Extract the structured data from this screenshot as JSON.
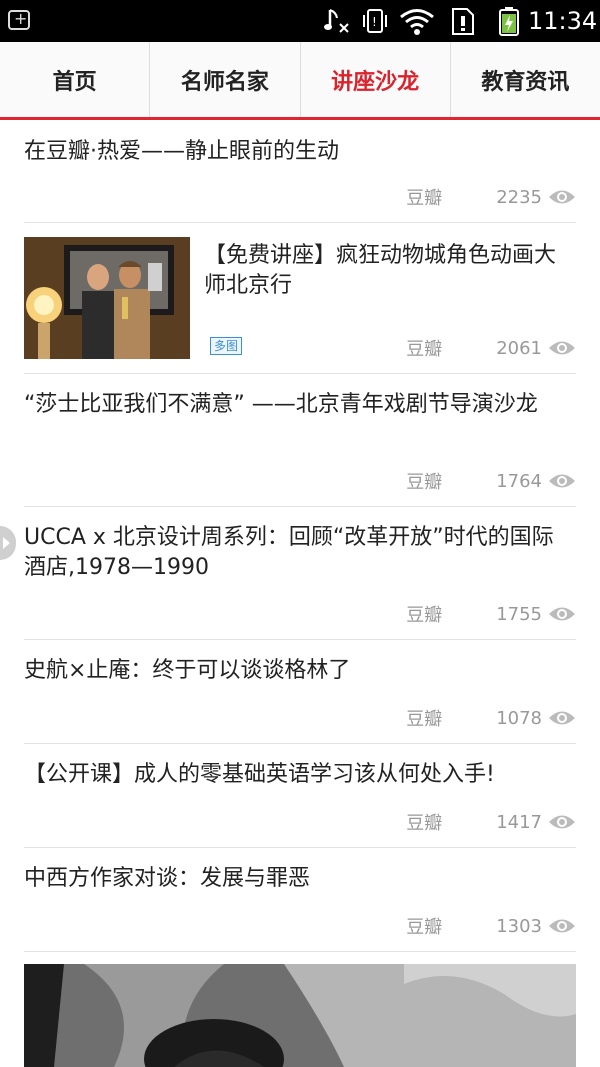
{
  "status_bar": {
    "time": "11:34",
    "icons": [
      "notification-icon",
      "music-muted-icon",
      "vibrate-icon",
      "wifi-icon",
      "sim-alert-icon",
      "battery-charging-icon"
    ]
  },
  "tabs": [
    {
      "label": "首页",
      "active": false
    },
    {
      "label": "名师名家",
      "active": false
    },
    {
      "label": "讲座沙龙",
      "active": true
    },
    {
      "label": "教育资讯",
      "active": false
    }
  ],
  "accent_color": "#d9232d",
  "articles": [
    {
      "title": "在豆瓣·热爱——静止眼前的生动",
      "source": "豆瓣",
      "views": "2235"
    },
    {
      "title": "【免费讲座】疯狂动物城角色动画大师北京行",
      "source": "豆瓣",
      "views": "2061",
      "tag": "多图"
    },
    {
      "title": "“莎士比亚我们不满意” ——北京青年戏剧节导演沙龙",
      "source": "豆瓣",
      "views": "1764"
    },
    {
      "title": "UCCA x 北京设计周系列：回顾“改革开放”时代的国际酒店,1978—1990",
      "source": "豆瓣",
      "views": "1755"
    },
    {
      "title": "史航×止庵：终于可以谈谈格林了",
      "source": "豆瓣",
      "views": "1078"
    },
    {
      "title": "【公开课】成人的零基础英语学习该从何处入手!",
      "source": "豆瓣",
      "views": "1417"
    },
    {
      "title": "中西方作家对谈：发展与罪恶",
      "source": "豆瓣",
      "views": "1303"
    }
  ]
}
